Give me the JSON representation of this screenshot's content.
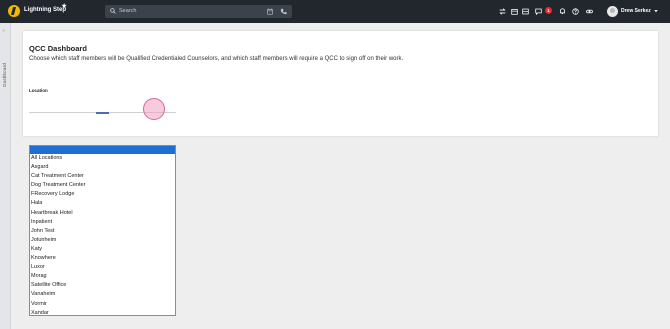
{
  "topbar": {
    "app_title": "Lightning Step",
    "search_placeholder": "Search",
    "notification_count": "1",
    "user_name": "Drew Serkez"
  },
  "rail": {
    "label": "Dashboard"
  },
  "main": {
    "title": "QCC Dashboard",
    "description": "Choose which staff members will be Qualified Credentialed Counselors, and which staff members will require a QCC to sign off on their work.",
    "location_label": "Location"
  },
  "dropdown": {
    "options": [
      "All Locations",
      "Asgard",
      "Cat Treatment Center",
      "Dog Treatment Center",
      "FRecovery Lodge",
      "Hala",
      "Heartbreak Hotel",
      "Inpatient",
      "John Test",
      "Jotunheim",
      "Katy",
      "Knowhere",
      "Luxor",
      "Morag",
      "Satellite Office",
      "Vanaheim",
      "Vormir",
      "Xandar"
    ]
  },
  "colors": {
    "topbar_bg": "#22272e",
    "accent_blue": "#1f6fd2",
    "badge_red": "#e02d2d",
    "logo_yellow": "#f5b800"
  }
}
